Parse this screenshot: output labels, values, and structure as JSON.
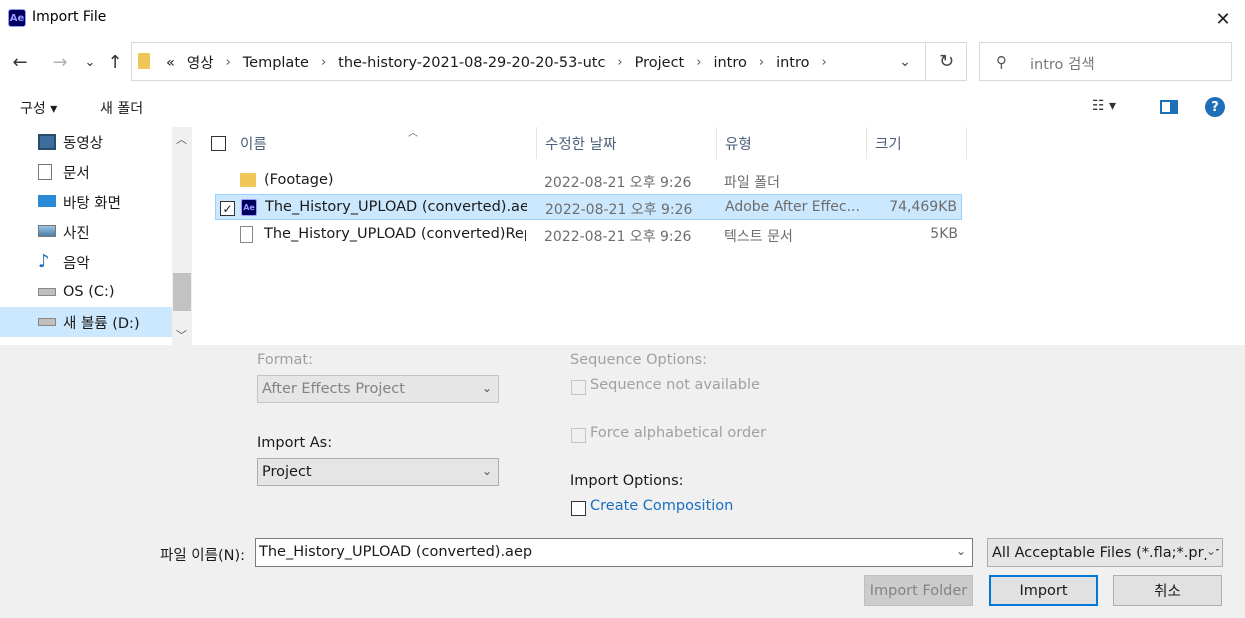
{
  "window": {
    "title": "Import File",
    "app_icon_text": "Ae",
    "close_glyph": "✕"
  },
  "nav": {
    "back": "←",
    "forward": "→",
    "recent": "⌄",
    "up": "↑",
    "overflow": "«",
    "breadcrumbs": [
      "영상",
      "Template",
      "the-history-2021-08-29-20-20-53-utc",
      "Project",
      "intro",
      "intro"
    ],
    "search_placeholder": "intro 검색"
  },
  "toolbar": {
    "organize": "구성 ▾",
    "new_folder": "새 폴더",
    "view_icon": "☷ ▾",
    "help": "?"
  },
  "sidebar": {
    "items": [
      {
        "label": "동영상",
        "icon": "videos-icon"
      },
      {
        "label": "문서",
        "icon": "documents-icon"
      },
      {
        "label": "바탕 화면",
        "icon": "desktop-icon"
      },
      {
        "label": "사진",
        "icon": "pictures-icon"
      },
      {
        "label": "음악",
        "icon": "music-icon"
      },
      {
        "label": "OS (C:)",
        "icon": "drive-icon"
      },
      {
        "label": "새 볼륨 (D:)",
        "icon": "drive-icon",
        "selected": true
      }
    ]
  },
  "filelist": {
    "columns": {
      "name": "이름",
      "date": "수정한 날짜",
      "type": "유형",
      "size": "크기"
    },
    "rows": [
      {
        "name": "(Footage)",
        "date": "2022-08-21 오후 9:26",
        "type": "파일 폴더",
        "size": "",
        "icon": "folder-icon"
      },
      {
        "name": "The_History_UPLOAD (converted).aep",
        "date": "2022-08-21 오후 9:26",
        "type": "Adobe After Effec...",
        "size": "74,469KB",
        "icon": "ae-file-icon",
        "selected": true
      },
      {
        "name": "The_History_UPLOAD (converted)Rep...",
        "date": "2022-08-21 오후 9:26",
        "type": "텍스트 문서",
        "size": "5KB",
        "icon": "text-file-icon"
      }
    ]
  },
  "options": {
    "format_label": "Format:",
    "format_value": "After Effects Project",
    "import_as_label": "Import As:",
    "import_as_value": "Project",
    "sequence_options_label": "Sequence Options:",
    "sequence_not_available": "Sequence not available",
    "force_alpha": "Force alphabetical order",
    "import_options_label": "Import Options:",
    "create_composition": "Create Composition"
  },
  "footer": {
    "filename_label": "파일 이름(N):",
    "filename_value": "The_History_UPLOAD (converted).aep",
    "filetype_value": "All Acceptable Files (*.fla;*.prpr",
    "import_folder": "Import Folder",
    "import": "Import",
    "cancel": "취소"
  },
  "colors": {
    "accent": "#0078d7",
    "selection": "#cce8ff",
    "link": "#1a6fbf"
  }
}
